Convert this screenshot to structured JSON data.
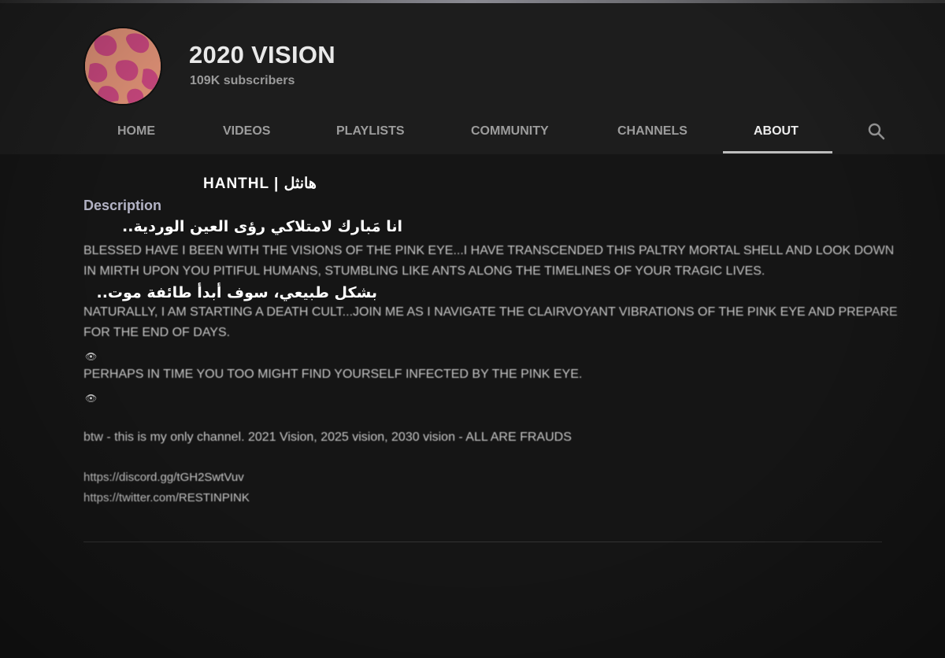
{
  "channel": {
    "name": "2020 VISION",
    "subscribers": "109K subscribers",
    "avatar_colors": [
      "#d98d73",
      "#c2457a",
      "#e0a068"
    ]
  },
  "tabs": [
    {
      "label": "HOME",
      "active": false
    },
    {
      "label": "VIDEOS",
      "active": false
    },
    {
      "label": "PLAYLISTS",
      "active": false
    },
    {
      "label": "COMMUNITY",
      "active": false
    },
    {
      "label": "CHANNELS",
      "active": false
    },
    {
      "label": "ABOUT",
      "active": true
    }
  ],
  "search_icon": "search-icon",
  "watermark": "HANTHL | هانثل",
  "about": {
    "description_title": "Description",
    "arabic_line_1": "انا مَبارك لامتلاكي رؤى العين الوردية..",
    "paragraph_1": "BLESSED HAVE I BEEN WITH THE VISIONS OF THE PINK EYE...I HAVE TRANSCENDED THIS PALTRY MORTAL SHELL AND LOOK DOWN IN MIRTH UPON YOU PITIFUL HUMANS, STUMBLING LIKE ANTS ALONG THE TIMELINES OF YOUR TRAGIC LIVES.",
    "arabic_line_2": "بشكل طبيعي، سوف أبدأ طائفة موت..",
    "paragraph_2": "NATURALLY, I AM STARTING A DEATH CULT...JOIN ME AS I NAVIGATE THE CLAIRVOYANT VIBRATIONS OF THE PINK EYE AND PREPARE FOR THE END OF DAYS.",
    "eye_emoji": "👁",
    "paragraph_3": "PERHAPS IN TIME YOU TOO MIGHT FIND YOURSELF INFECTED BY THE PINK EYE.",
    "paragraph_4": "btw - this is my only channel. 2021 Vision, 2025 vision, 2030 vision - ALL ARE FRAUDS",
    "links": [
      "https://discord.gg/tGH2SwtVuv",
      "https://twitter.com/RESTINPINK"
    ]
  }
}
